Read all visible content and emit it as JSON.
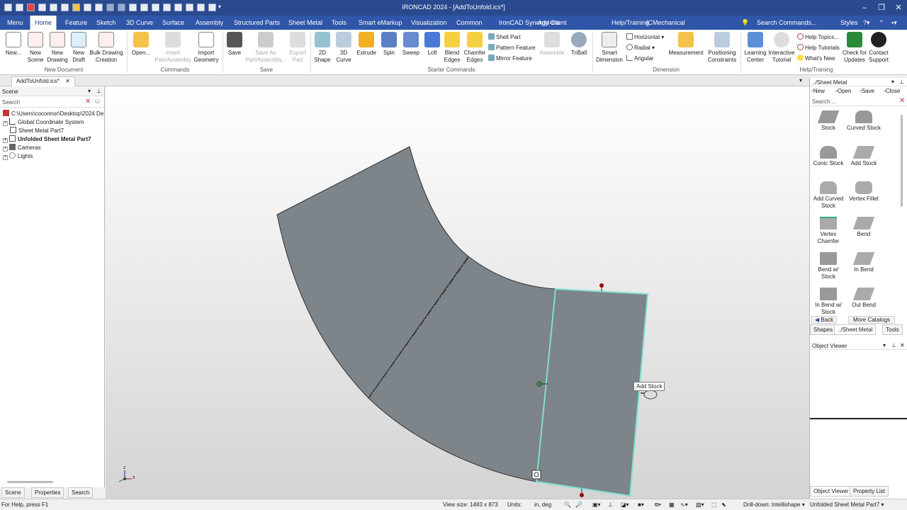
{
  "window": {
    "title": "IRONCAD 2024 - [AddToUnfold.ics*]"
  },
  "menu": {
    "file": "Menu",
    "tabs": [
      "Home",
      "Feature",
      "Sketch",
      "3D Curve",
      "Surface",
      "Assembly",
      "Structured Parts",
      "Sheet Metal",
      "Tools",
      "Smart eMarkup",
      "Visualization",
      "Common",
      "IronCAD Synergy Client",
      "Add-Ins",
      "Help/Training",
      "ICMechanical"
    ],
    "search_placeholder": "Search Commands...",
    "styles": "Styles"
  },
  "ribbon": {
    "new_document": {
      "group": "New Document",
      "buttons": [
        "New...",
        "New\nScene",
        "New\nDrawing",
        "New\nDraft",
        "Bulk Drawing\nCreation"
      ]
    },
    "commands": {
      "group": "Commands",
      "buttons": [
        "Open...",
        "Insert\nPart/Assembly",
        "Import\nGeometry"
      ]
    },
    "save": {
      "group": "Save",
      "buttons": [
        "Save",
        "Save As\nPart/Assembly...",
        "Export\nPart"
      ]
    },
    "starter": {
      "group": "Starter Commands",
      "buttons": [
        "2D\nShape",
        "3D\nCurve",
        "Extrude",
        "Spin",
        "Sweep",
        "Loft",
        "Blend\nEdges",
        "Chamfer\nEdges"
      ],
      "small": [
        "Shell Part",
        "Pattern Feature",
        "Mirror Feature"
      ],
      "more": [
        "Assemble",
        "TriBall"
      ]
    },
    "dimension": {
      "group": "Dimension",
      "buttons": [
        "Smart\nDimension"
      ],
      "small": [
        "Horizontal",
        "Radial",
        "Angular"
      ],
      "more": [
        "Measurement",
        "Positioning\nConstraints"
      ]
    },
    "help": {
      "group": "Help/Training",
      "buttons": [
        "Learning\nCenter",
        "Interactive\nTutorial"
      ],
      "small": [
        "Help Topics...",
        "Help Tutorials",
        "What's New"
      ],
      "more": [
        "Check for\nUpdates",
        "Contact\nSupport"
      ]
    }
  },
  "doc_tab": "AddToUnfold.ics*",
  "scene": {
    "title": "Scene",
    "search_placeholder": "Search",
    "items": [
      "C:\\Users\\coconnor\\Desktop\\2024 De",
      "Global Coordinate System",
      "Sheet Metal Part7",
      "Unfolded Sheet Metal Part7",
      "Cameras",
      "Lights"
    ],
    "tabs": [
      "Scene",
      "Properties",
      "Search"
    ]
  },
  "catalog": {
    "title": "../Sheet Metal",
    "buttons": [
      "New",
      "Open",
      "Save",
      "Close"
    ],
    "search_placeholder": "Search ...",
    "items": [
      "Stock",
      "Curved Stock",
      "Conic Stock",
      "Add Stock",
      "Add Curved\nStock",
      "Vertex Fillet",
      "Vertex\nChamfer",
      "Bend",
      "Bend w/\nStock",
      "In Bend",
      "In Bend w/\nStock",
      "Out Bend"
    ],
    "back": "Back",
    "more": "More Catalogs",
    "tabs": [
      "Shapes",
      "../Sheet Metal",
      "Tools"
    ]
  },
  "object_viewer": {
    "title": "Object Viewer",
    "tabs": [
      "Object Viewer",
      "Property List"
    ]
  },
  "viewport": {
    "tooltip": "Add Stock",
    "triad": [
      "z",
      "x"
    ]
  },
  "status": {
    "help": "For Help, press F1",
    "view_size": "View size: 1483 x  873",
    "units_label": "Units:",
    "units_value": "in, deg",
    "drilldown": "Drill-down: Intellishape",
    "selection": "Unfolded Sheet Metal Part7"
  },
  "colors": {
    "title_bar": "#2a4a8f",
    "menu_bar": "#2f56a8",
    "part": "#7d848a",
    "highlight": "#7fe0cf"
  }
}
